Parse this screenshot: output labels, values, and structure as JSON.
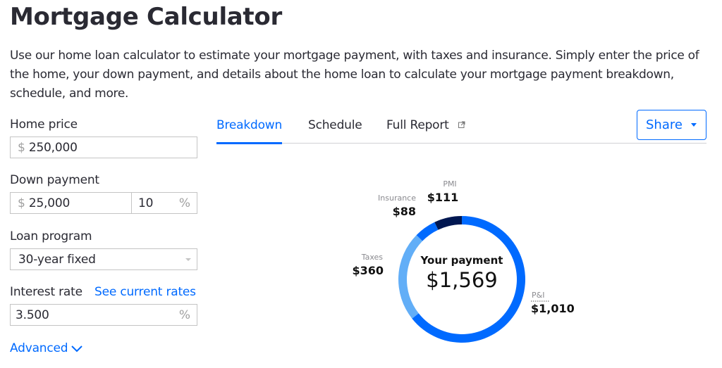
{
  "page": {
    "title": "Mortgage Calculator",
    "intro": "Use our home loan calculator to estimate your mortgage payment, with taxes and insurance. Simply enter the price of the home, your down payment, and details about the home loan to calculate your mortgage payment breakdown, schedule, and more."
  },
  "form": {
    "home_price": {
      "label": "Home price",
      "prefix": "$",
      "value": "250,000"
    },
    "down_payment": {
      "label": "Down payment",
      "prefix": "$",
      "value": "25,000",
      "percent_value": "10",
      "percent_suffix": "%"
    },
    "loan_program": {
      "label": "Loan program",
      "selected": "30-year fixed"
    },
    "interest_rate": {
      "label": "Interest rate",
      "link": "See current rates",
      "value": "3.500",
      "suffix": "%"
    },
    "advanced_label": "Advanced"
  },
  "tabs": [
    {
      "label": "Breakdown",
      "active": true
    },
    {
      "label": "Schedule",
      "active": false
    },
    {
      "label": "Full Report",
      "active": false,
      "icon": "external-link-icon"
    }
  ],
  "share_button": {
    "label": "Share",
    "icon": "caret-down-icon"
  },
  "colors": {
    "accent": "#006aff",
    "pi": "#006aff",
    "taxes": "#62aef7",
    "insurance": "#006aff",
    "pmi": "#001751"
  },
  "chart_data": {
    "type": "pie",
    "variant": "donut",
    "center_title": "Your payment",
    "center_value": "$1,569",
    "total": 1569,
    "series": [
      {
        "name": "P&I",
        "value": 1010,
        "label": "$1,010",
        "color": "#006aff"
      },
      {
        "name": "Taxes",
        "value": 360,
        "label": "$360",
        "color": "#62aef7"
      },
      {
        "name": "Insurance",
        "value": 88,
        "label": "$88",
        "color": "#006aff"
      },
      {
        "name": "PMI",
        "value": 111,
        "label": "$111",
        "color": "#001751"
      }
    ],
    "start_angle": "12 o'clock",
    "direction": "clockwise"
  }
}
